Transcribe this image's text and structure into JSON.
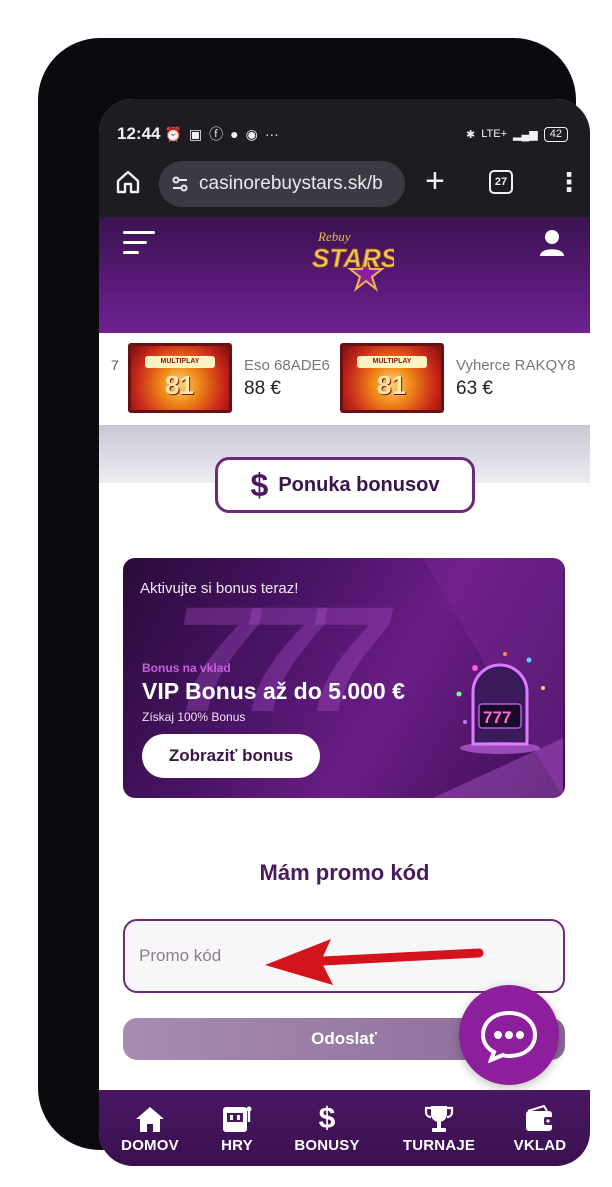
{
  "statusbar": {
    "time": "12:44",
    "network": "LTE+",
    "battery": "42"
  },
  "browser": {
    "url": "casinorebuystars.sk/b",
    "tab_count": "27"
  },
  "header": {
    "logo_top": "Rebuy",
    "logo_main": "STARS"
  },
  "ticker": {
    "cut_text": "7",
    "winners": [
      {
        "game_band": "MULTIPLAY",
        "game_num": "81",
        "name": "Eso 68ADE6",
        "amount": "88 €"
      },
      {
        "game_band": "MULTIPLAY",
        "game_num": "81",
        "name": "Vyherce RAKQY8",
        "amount": "63 €"
      }
    ]
  },
  "bonus_offer": {
    "icon": "$",
    "label": "Ponuka bonusov"
  },
  "banner": {
    "pre_title": "Aktivujte si bonus teraz!",
    "tag": "Bonus na vklad",
    "title": "VIP Bonus až do 5.000 €",
    "subtitle": "Získaj 100% Bonus",
    "cta": "Zobraziť bonus"
  },
  "promo": {
    "title": "Mám promo kód",
    "placeholder": "Promo kód",
    "submit": "Odoslať"
  },
  "nav": {
    "items": [
      {
        "label": "DOMOV",
        "icon": "home-icon"
      },
      {
        "label": "HRY",
        "icon": "slot-machine-icon"
      },
      {
        "label": "BONUSY",
        "icon": "dollar-icon"
      },
      {
        "label": "TURNAJE",
        "icon": "trophy-icon"
      },
      {
        "label": "VKLAD",
        "icon": "wallet-icon"
      }
    ]
  },
  "colors": {
    "brand_purple": "#5a1a78",
    "accent_magenta": "#8e1f9c",
    "arrow_red": "#d3141c"
  }
}
